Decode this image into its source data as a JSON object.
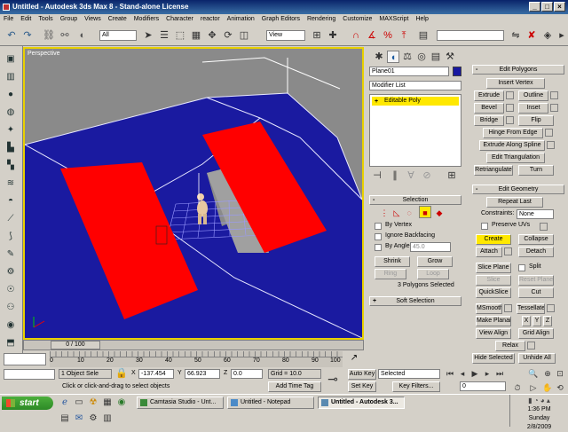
{
  "window": {
    "title": "Untitled - Autodesk 3ds Max 8  -  Stand-alone License"
  },
  "menu": [
    "File",
    "Edit",
    "Tools",
    "Group",
    "Views",
    "Create",
    "Modifiers",
    "Character",
    "reactor",
    "Animation",
    "Graph Editors",
    "Rendering",
    "Customize",
    "MAXScript",
    "Help"
  ],
  "toolbar": {
    "selection_filter": "All",
    "ref_coord": "View",
    "named_sel_placeholder": ""
  },
  "viewport": {
    "label": "Perspective"
  },
  "modify_panel": {
    "object_name": "Plane01",
    "modifier_list": "Modifier List",
    "stack_item": "Editable Poly",
    "selection_title": "Selection",
    "by_vertex": "By Vertex",
    "ignore_backfacing": "Ignore Backfacing",
    "by_angle": "By Angle:",
    "by_angle_value": "45.0",
    "shrink": "Shrink",
    "grow": "Grow",
    "ring": "Ring",
    "loop": "Loop",
    "selected_count": "3 Polygons Selected",
    "soft_selection": "Soft Selection"
  },
  "edit_polygons": {
    "title": "Edit Polygons",
    "insert_vertex": "Insert Vertex",
    "extrude": "Extrude",
    "outline": "Outline",
    "bevel": "Bevel",
    "inset": "Inset",
    "bridge": "Bridge",
    "flip": "Flip",
    "hinge": "Hinge From Edge",
    "extrude_spline": "Extrude Along Spline",
    "edit_triangulation": "Edit Triangulation",
    "retriangulate": "Retriangulate",
    "turn": "Turn"
  },
  "edit_geometry": {
    "title": "Edit Geometry",
    "repeat_last": "Repeat Last",
    "constraints_label": "Constraints:",
    "constraints_value": "None",
    "preserve_uvs": "Preserve UVs",
    "create": "Create",
    "collapse": "Collapse",
    "attach": "Attach",
    "detach": "Detach",
    "slice_plane": "Slice Plane",
    "split": "Split",
    "slice": "Slice",
    "reset_plane": "Reset Plane",
    "quickslice": "QuickSlice",
    "cut": "Cut",
    "msmooth": "MSmooth",
    "tessellate": "Tessellate",
    "make_planar": "Make Planar",
    "x": "X",
    "y": "Y",
    "z": "Z",
    "view_align": "View Align",
    "grid_align": "Grid Align",
    "relax": "Relax",
    "hide_selected": "Hide Selected",
    "unhide_all": "Unhide All"
  },
  "timeline": {
    "frame": "0 / 100",
    "ticks": [
      "0",
      "10",
      "20",
      "30",
      "40",
      "50",
      "60",
      "70",
      "80",
      "90",
      "100"
    ]
  },
  "status": {
    "selection": "1 Object Sele",
    "prompt": "Click or click-and-drag to select objects",
    "x_label": "X",
    "x_value": "-137.454",
    "y_label": "Y",
    "y_value": "66.923",
    "z_label": "Z",
    "z_value": "0.0",
    "grid": "Grid = 10.0",
    "add_time_tag": "Add Time Tag",
    "auto_key": "Auto Key",
    "set_key": "Set Key",
    "key_mode": "Selected",
    "key_filters": "Key Filters...",
    "frame_value": "0"
  },
  "taskbar": {
    "start": "start",
    "items": [
      "Camtasia Studio - Unt...",
      "Untitled - Notepad",
      "Untitled - Autodesk 3..."
    ],
    "time": "1:36 PM",
    "day": "Sunday",
    "date": "2/8/2009"
  },
  "colors": {
    "selected_face": "#ff0000",
    "ground": "#1a1aa0",
    "active_viewport_border": "#e8d000",
    "yellow_button": "#ffe800"
  }
}
